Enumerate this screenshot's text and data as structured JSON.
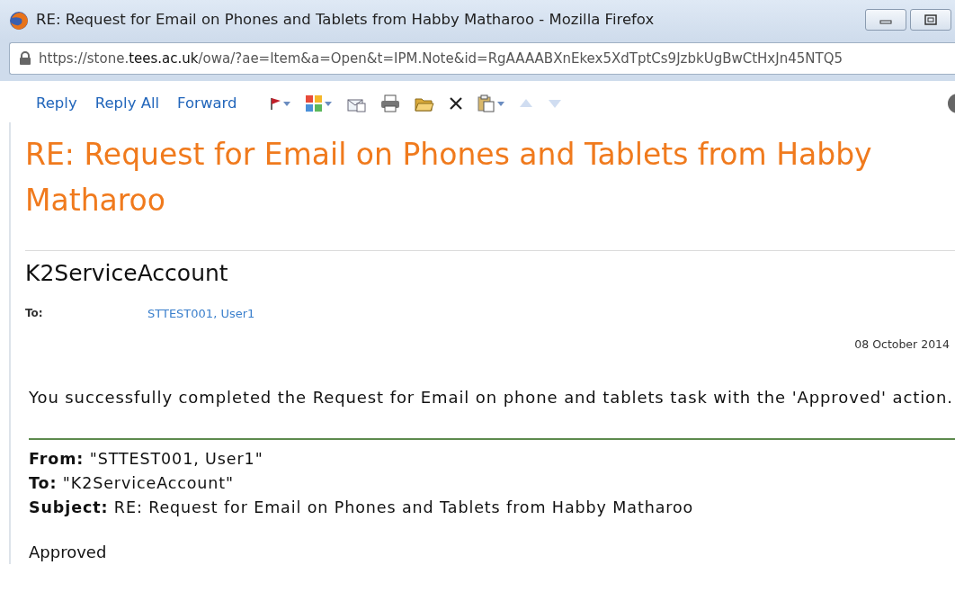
{
  "window": {
    "title": "RE: Request for Email on Phones and Tablets from Habby Matharoo - Mozilla Firefox"
  },
  "address_bar": {
    "url": "https://stone.**tees.ac.uk**/owa/?ae=Item&a=Open&t=IPM.Note&id=RgAAAABXnEkex5XdTptCs9JzbkUgBwCtHxJn45NTQ5"
  },
  "toolbar": [
    {
      "kind": "text",
      "label": "Reply"
    },
    {
      "kind": "text",
      "label": "Reply All"
    },
    {
      "kind": "text",
      "label": "Forward"
    },
    {
      "kind": "flag",
      "dropdown": true,
      "disabled": false
    },
    {
      "kind": "categories",
      "dropdown": true,
      "disabled": false
    },
    {
      "kind": "envelope",
      "dropdown": false,
      "disabled": false
    },
    {
      "kind": "printer",
      "dropdown": false,
      "disabled": false
    },
    {
      "kind": "folder",
      "dropdown": false,
      "disabled": false
    },
    {
      "kind": "delete",
      "dropdown": false,
      "disabled": false
    },
    {
      "kind": "clipboard",
      "dropdown": true,
      "disabled": false
    },
    {
      "kind": "up",
      "dropdown": false,
      "disabled": true
    },
    {
      "kind": "down",
      "dropdown": false,
      "disabled": true
    }
  ],
  "message": {
    "subject": "RE: Request for Email on Phones and Tablets from Habby Matharoo",
    "sender": "K2ServiceAccount",
    "to_label": "To:",
    "to_value": "STTEST001, User1",
    "date": "08 October 2014",
    "body": "You successfully completed the Request for Email on phone and tablets task with the 'Approved' action.",
    "quoted": [
      "**From:** \"STTEST001, User1\"",
      "**To:** \"K2ServiceAccount\"",
      "**Subject:** RE: Request for Email on Phones and Tablets from Habby Matharoo"
    ],
    "reply_text": "Approved"
  }
}
